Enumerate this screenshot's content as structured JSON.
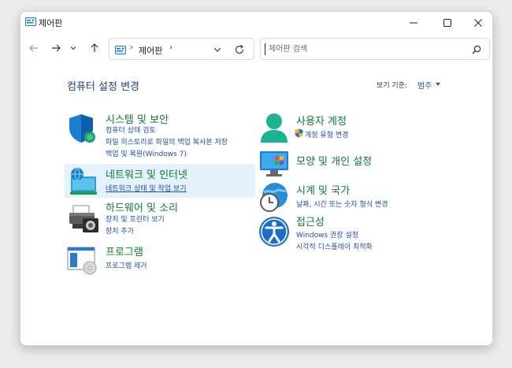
{
  "window": {
    "title": "제어판"
  },
  "nav": {
    "address": "제어판",
    "address_sep": "›",
    "search_placeholder": "제어판 검색"
  },
  "content": {
    "page_title": "컴퓨터 설정 변경",
    "view_by_label": "보기 기준:",
    "view_by_value": "범주"
  },
  "categories": [
    {
      "title": "시스템 및 보안",
      "links": [
        "컴퓨터 상태 검토",
        "파일 히스토리로 파일의 백업 복사본 저장",
        "백업 및 복원(Windows 7)"
      ]
    },
    {
      "title": "네트워크 및 인터넷",
      "links": [
        "네트워크 상태 및 작업 보기"
      ]
    },
    {
      "title": "하드웨어 및 소리",
      "links": [
        "장치 및 프린터 보기",
        "장치 추가"
      ]
    },
    {
      "title": "프로그램",
      "links": [
        "프로그램 제거"
      ]
    },
    {
      "title": "사용자 계정",
      "links": [
        "계정 유형 변경"
      ]
    },
    {
      "title": "모양 및 개인 설정",
      "links": []
    },
    {
      "title": "시계 및 국가",
      "links": [
        "날짜, 시간 또는 숫자 형식 변경"
      ]
    },
    {
      "title": "접근성",
      "links": [
        "Windows 권장 설정",
        "시각적 디스플레이 최적화"
      ]
    }
  ],
  "colors": {
    "category_title": "#0f7a32",
    "link": "#1c4fa8",
    "page_title": "#1e3f8a",
    "hover_bg": "#e5f1fb"
  },
  "icons": [
    "control-panel-icon",
    "minimize-icon",
    "maximize-icon",
    "close-icon",
    "back-arrow-icon",
    "forward-arrow-icon",
    "chevron-down-icon",
    "up-arrow-icon",
    "refresh-icon",
    "search-icon",
    "shield-icon",
    "network-icon",
    "printer-icon",
    "programs-icon",
    "user-icon",
    "uac-shield-icon",
    "personalization-icon",
    "clock-globe-icon",
    "accessibility-icon"
  ]
}
